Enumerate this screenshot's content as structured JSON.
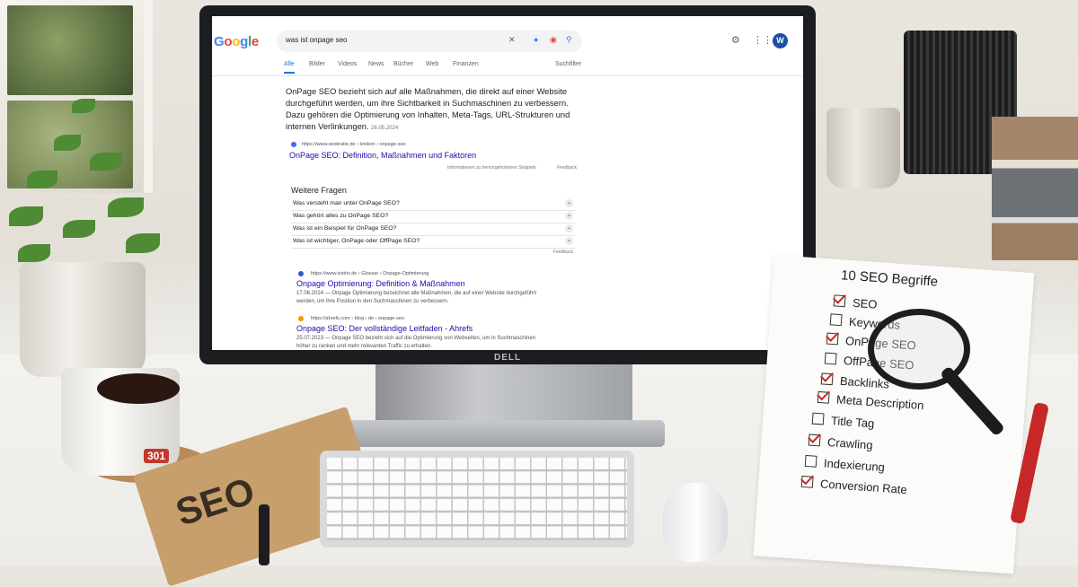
{
  "scene": {
    "monitor_brand": "DELL",
    "mug_badge": "301",
    "notebook_title": "SEO"
  },
  "google": {
    "logo": "Google",
    "query": "was ist onpage seo",
    "avatar_letter": "W",
    "tabs": [
      "Alle",
      "Bilder",
      "Videos",
      "News",
      "Bücher",
      "Web",
      "Finanzen"
    ],
    "tools_label": "Suchfilter",
    "featured_snippet": "OnPage SEO bezieht sich auf alle Maßnahmen, die direkt auf einer Website durchgeführt werden, um ihre Sichtbarkeit in Suchmaschinen zu verbessern. Dazu gehören die Optimierung von Inhalten, Meta-Tags, URL-Strukturen und internen Verlinkungen.",
    "featured_date": "26.05.2024",
    "featured_cite": "https://www.seokratie.de › lexikon › onpage-seo",
    "featured_title": "OnPage SEO: Definition, Maßnahmen und Faktoren",
    "snippet_info": "Informationen zu hervorgehobenen Snippets",
    "feedback": "Feedback",
    "paa_title": "Weitere Fragen",
    "paa": [
      "Was versteht man unter OnPage SEO?",
      "Was gehört alles zu OnPage SEO?",
      "Was ist ein Beispiel für OnPage SEO?",
      "Was ist wichtiger, OnPage oder OffPage SEO?"
    ],
    "results": [
      {
        "cite": "https://www.sistrix.de › Glossar › Onpage-Optimierung",
        "title": "Onpage Optimierung: Definition & Maßnahmen",
        "desc": "17.06.2024 — Onpage Optimierung bezeichnet alle Maßnahmen, die auf einer Website durchgeführt werden, um ihre Position in den Suchmaschinen zu verbessern."
      },
      {
        "cite": "https://ahrefs.com › blog › de › onpage-seo",
        "title": "Onpage SEO: Der vollständige Leitfaden - Ahrefs",
        "desc": "25.07.2023 — Onpage SEO bezieht sich auf die Optimierung von Webseiten, um in Suchmaschinen höher zu ranken und mehr relevanten Traffic zu erhalten."
      }
    ]
  },
  "checklist": {
    "title": "10 SEO Begriffe",
    "items": [
      {
        "label": "SEO",
        "checked": true
      },
      {
        "label": "Keywords",
        "checked": false
      },
      {
        "label": "OnPage SEO",
        "checked": true
      },
      {
        "label": "OffPage SEO",
        "checked": false
      },
      {
        "label": "Backlinks",
        "checked": true
      },
      {
        "label": "Meta Description",
        "checked": true
      },
      {
        "label": "Title Tag",
        "checked": false
      },
      {
        "label": "Crawling",
        "checked": true
      },
      {
        "label": "Indexierung",
        "checked": false
      },
      {
        "label": "Conversion Rate",
        "checked": true
      }
    ]
  }
}
